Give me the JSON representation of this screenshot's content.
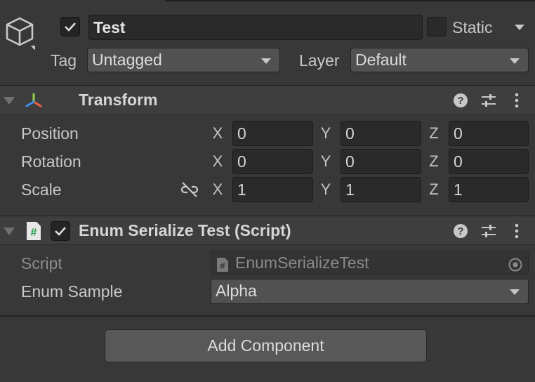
{
  "header": {
    "active_checked": true,
    "object_name": "Test",
    "static_label": "Static",
    "static_checked": false,
    "tag_label": "Tag",
    "tag_value": "Untagged",
    "layer_label": "Layer",
    "layer_value": "Default",
    "object_icon": "cube-icon"
  },
  "transform": {
    "title": "Transform",
    "icon": "transform-axes-icon",
    "rows": {
      "position": {
        "label": "Position",
        "x": "0",
        "y": "0",
        "z": "0"
      },
      "rotation": {
        "label": "Rotation",
        "x": "0",
        "y": "0",
        "z": "0"
      },
      "scale": {
        "label": "Scale",
        "x": "1",
        "y": "1",
        "z": "1"
      }
    },
    "axes": {
      "x": "X",
      "y": "Y",
      "z": "Z"
    }
  },
  "script_component": {
    "title": "Enum Serialize Test (Script)",
    "enabled": true,
    "icon": "csharp-script-icon",
    "script_label": "Script",
    "script_value": "EnumSerializeTest",
    "enum_label": "Enum Sample",
    "enum_value": "Alpha"
  },
  "add_component_label": "Add Component",
  "colors": {
    "background": "#383838",
    "field": "#2a2a2a",
    "dropdown": "#515151"
  }
}
